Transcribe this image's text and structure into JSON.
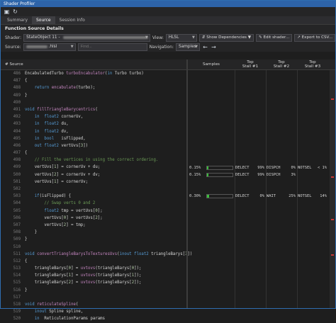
{
  "window": {
    "title": "Shader Profiler"
  },
  "toolbar": {
    "icons": [
      "save-icon",
      "refresh-icon"
    ]
  },
  "tabs": [
    {
      "label": "Summary"
    },
    {
      "label": "Source"
    },
    {
      "label": "Session Info"
    }
  ],
  "section": {
    "title": "Function Source Details"
  },
  "shader_row": {
    "shader_label": "Shader:",
    "shader_value": "StateObject 11 -",
    "view_label": "View:",
    "view_value": "HLSL",
    "show_deps": "Show Dependencies",
    "edit_shader": "Edit shader...",
    "export_csv": "Export to CSV..."
  },
  "source_row": {
    "source_label": "Source:",
    "source_value": ".hlsl",
    "find_placeholder": "Find...",
    "navigation_label": "Navigation:",
    "navigation_value": "Samples"
  },
  "columns": {
    "source": "# Source",
    "samples": "Samples",
    "stall1": "Top\nStall #1",
    "stall2": "Top\nStall #2",
    "stall3": "Top\nStall #3"
  },
  "code_lines": [
    {
      "n": "486",
      "t": "EncabulatedTurbo turboEncabulator(in Turbo turbo)"
    },
    {
      "n": "487",
      "t": "{"
    },
    {
      "n": "488",
      "t": "    return encabulate(turbo);"
    },
    {
      "n": "489",
      "t": "}"
    },
    {
      "n": "490",
      "t": ""
    },
    {
      "n": "491",
      "t": "void fillTriangleBarycentrics("
    },
    {
      "n": "492",
      "t": "    in  float2 cornerUv,"
    },
    {
      "n": "493",
      "t": "    in  float2 du,"
    },
    {
      "n": "494",
      "t": "    in  float2 dv,"
    },
    {
      "n": "495",
      "t": "    in  bool   isFlipped,"
    },
    {
      "n": "496",
      "t": "    out float2 vertUvs[3])"
    },
    {
      "n": "497",
      "t": "{"
    },
    {
      "n": "498",
      "t": "    // Fill the vertices in using the correct ordering."
    },
    {
      "n": "499",
      "t": "    vertUvs[1] = cornerUv + du;"
    },
    {
      "n": "500",
      "t": "    vertUvs[2] = cornerUv + dv;"
    },
    {
      "n": "501",
      "t": "    vertUvs[1] = cornerUv;"
    },
    {
      "n": "502",
      "t": ""
    },
    {
      "n": "503",
      "t": "    if(isFlipped) {"
    },
    {
      "n": "504",
      "t": "        // Swap verts 0 and 2"
    },
    {
      "n": "505",
      "t": "        float2 tmp = vertUvs[0];"
    },
    {
      "n": "506",
      "t": "        vertUvs[0] = vertUvs[2];"
    },
    {
      "n": "507",
      "t": "        vertUvs[2] = tmp;"
    },
    {
      "n": "508",
      "t": "    }"
    },
    {
      "n": "509",
      "t": "}"
    },
    {
      "n": "510",
      "t": ""
    },
    {
      "n": "511",
      "t": "void convertTriangleBarysToTexturesUvs(inout float2 triangleBarys[3])"
    },
    {
      "n": "512",
      "t": "{"
    },
    {
      "n": "513",
      "t": "    triangleBarys[0] = uvtovs(triangleBarys[0]);"
    },
    {
      "n": "514",
      "t": "    triangleBarys[1] = uvtovs(triangleBarys[1]);"
    },
    {
      "n": "515",
      "t": "    triangleBarys[2] = uvtovs(triangleBarys[2]);"
    },
    {
      "n": "516",
      "t": "}"
    },
    {
      "n": "517",
      "t": ""
    },
    {
      "n": "518",
      "t": "void reticulateSpline("
    },
    {
      "n": "519",
      "t": "    inout Spline spline,"
    },
    {
      "n": "520",
      "t": "    in  ReticulationParams params"
    }
  ],
  "stats_rows": [
    {
      "line_index": 13,
      "samples": "0.15%",
      "fill": 0.15,
      "s1": "DELECT",
      "p1": "99%",
      "s2": "DISPCH",
      "p2": "0%",
      "s3": "NOTSEL",
      "p3": "< 1%"
    },
    {
      "line_index": 14,
      "samples": "0.15%",
      "fill": 0.15,
      "s1": "DELECT",
      "p1": "99%",
      "s2": "DISPCH",
      "p2": "3%",
      "s3": "",
      "p3": ""
    },
    {
      "line_index": 17,
      "samples": "0.30%",
      "fill": 0.3,
      "s1": "DELECT",
      "p1": "0%",
      "s2": "WAIT",
      "p2": "25%",
      "s3": "NOTSEL",
      "p3": "14%"
    }
  ],
  "colors": {
    "accent": "#2d63a8",
    "keyword": "#569cd6",
    "type": "#4ec9b0",
    "func": "#c586c0",
    "comment": "#6a9955",
    "number": "#b5cea8",
    "bar": "#3cbf3c"
  }
}
